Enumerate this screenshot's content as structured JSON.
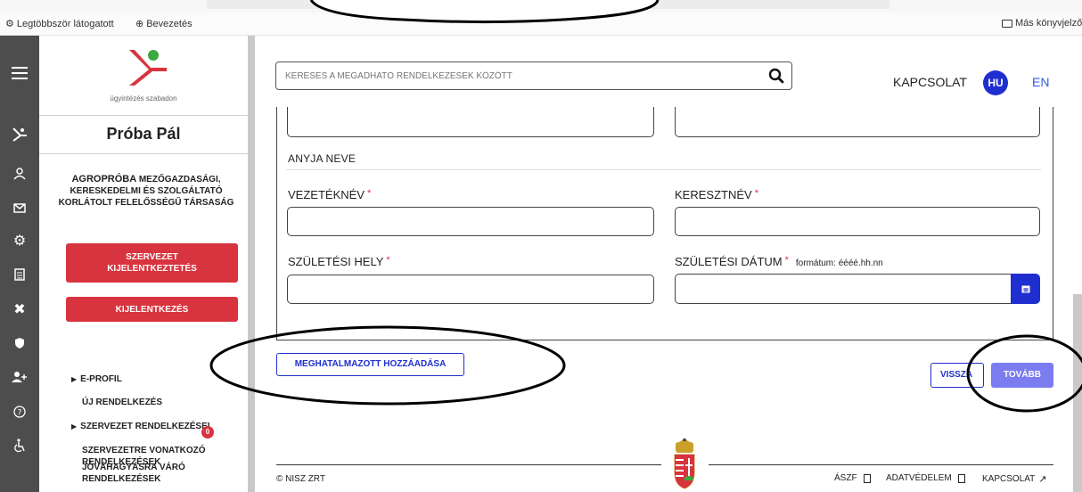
{
  "browser": {
    "bookmarks": [
      {
        "label": "Legtöbbször látogatott",
        "icon": "gear-icon"
      },
      {
        "label": "Bevezetés",
        "icon": "globe-icon"
      }
    ],
    "other_bookmarks": "Más könyvjelzők"
  },
  "sidebar": {
    "logo_caption": "ügyintézés szabadon",
    "user_name": "Próba Pál",
    "org_name_parts": [
      "AGROPRÓBA ",
      "MEZŐGAZDASÁGI, KERESKEDELMI ÉS SZOLGÁLTATÓ KORLÁTOLT FELELŐSSÉGŰ TÁRSASÁG"
    ],
    "org_logout_label": "SZERVEZET KIJELENTKEZTETÉS",
    "logout_label": "KIJELENTKEZÉS",
    "nav": [
      {
        "label": "E-PROFIL",
        "expandable": true
      },
      {
        "label": "ÚJ RENDELKEZÉS",
        "expandable": false
      },
      {
        "label": "SZERVEZET RENDELKEZÉSEI",
        "expandable": true
      },
      {
        "label": "SZERVEZETRE VONATKOZÓ RENDELKEZÉSEK",
        "expandable": false
      },
      {
        "label": "JÓVÁHAGYÁSRA VÁRÓ RENDELKEZÉSEK",
        "expandable": false,
        "badge": "0"
      }
    ],
    "rail_icons": [
      "menu-icon",
      "logo-icon",
      "user-icon",
      "mail-icon",
      "settings-icon",
      "document-icon",
      "tools-icon",
      "shield-icon",
      "add-user-icon",
      "help-icon",
      "accessibility-icon"
    ]
  },
  "header": {
    "search_placeholder": "KERESÉS A MEGADHATÓ RENDELKEZÉSEK KÖZÖTT",
    "contact": "KAPCSOLAT",
    "lang_active": "HU",
    "lang_other": "EN"
  },
  "form": {
    "section_title": "ANYJA NEVE",
    "last_name_label": "VEZETÉKNÉV",
    "first_name_label": "KERESZTNÉV",
    "birth_place_label": "SZÜLETÉSI HELY",
    "birth_date_label": "SZÜLETÉSI DÁTUM",
    "birth_date_hint": "formátum: éééé.hh.nn",
    "required_mark": "*",
    "last_name_value": "",
    "first_name_value": "",
    "birth_place_value": "",
    "birth_date_value": ""
  },
  "actions": {
    "add_proxy": "MEGHATALMAZOTT HOZZÁADÁSA",
    "back": "VISSZA",
    "next": "TOVÁBB"
  },
  "footer": {
    "copyright": "© NISZ ZRT",
    "links": [
      "ÁSZF",
      "ADATVÉDELEM",
      "KAPCSOLAT"
    ]
  },
  "colors": {
    "accent_blue": "#1f2ecf",
    "accent_red": "#d8343f",
    "next_button": "#7a7cf0",
    "rail_bg": "#4d4d4d"
  }
}
